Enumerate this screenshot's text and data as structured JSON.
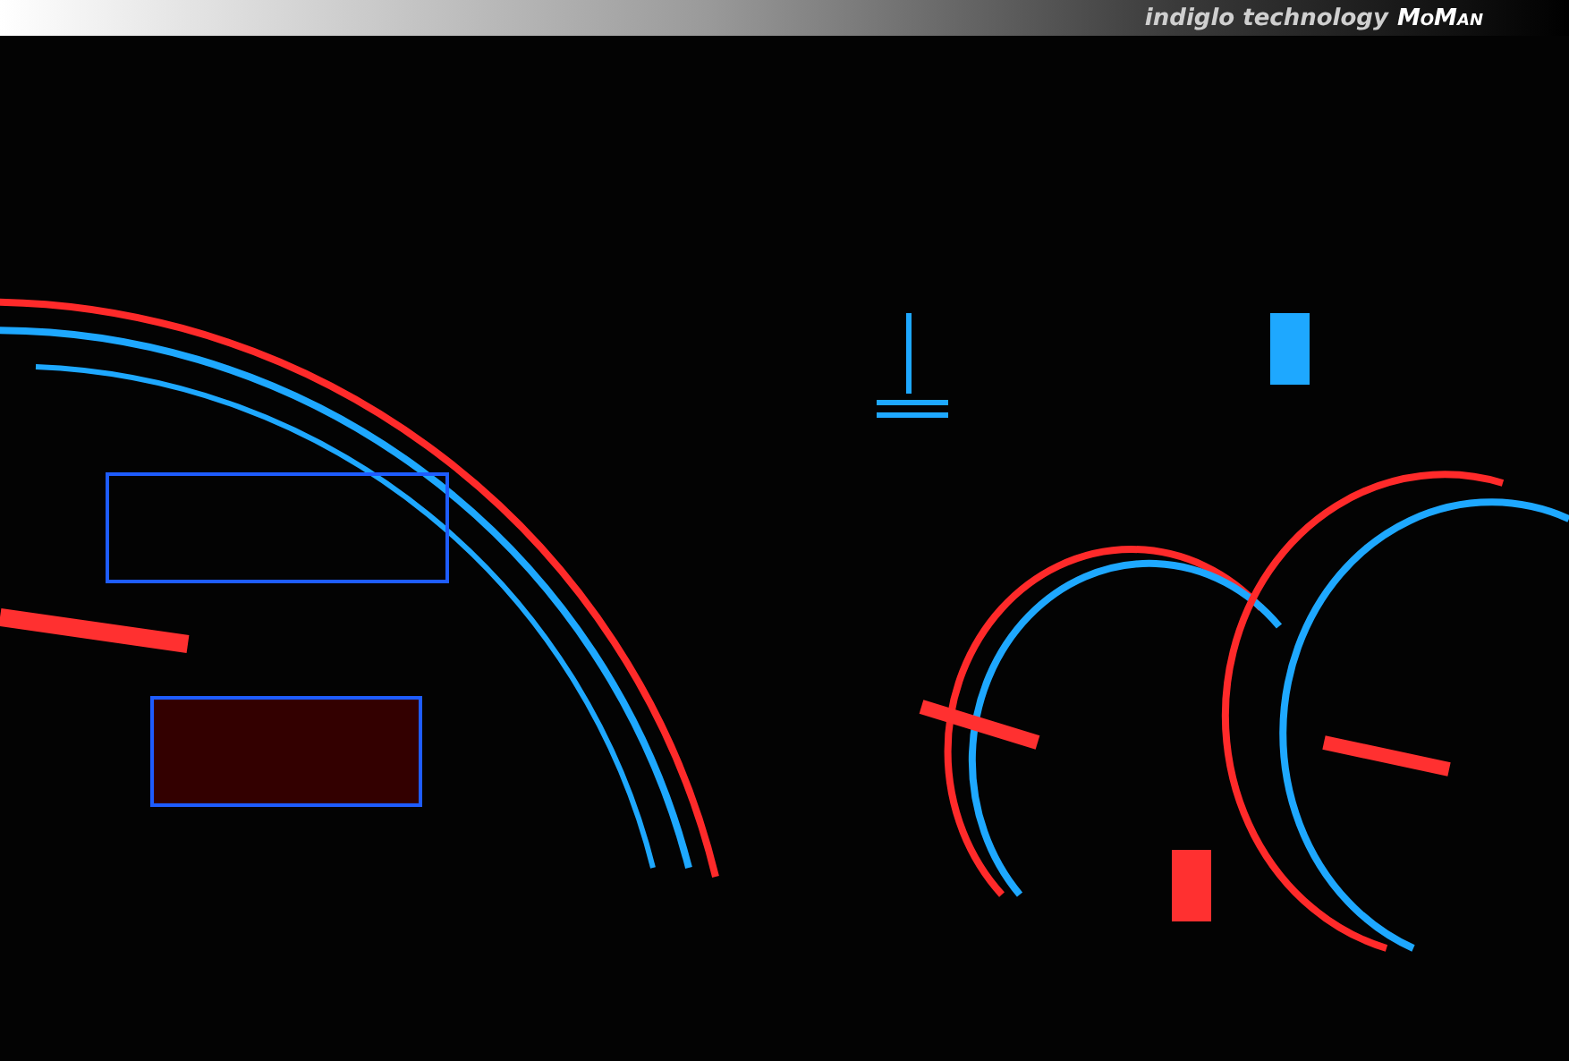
{
  "banner": {
    "tagline": "indiglo technology",
    "brand": "MoMan"
  },
  "photo": {
    "kind": "dashboard"
  }
}
